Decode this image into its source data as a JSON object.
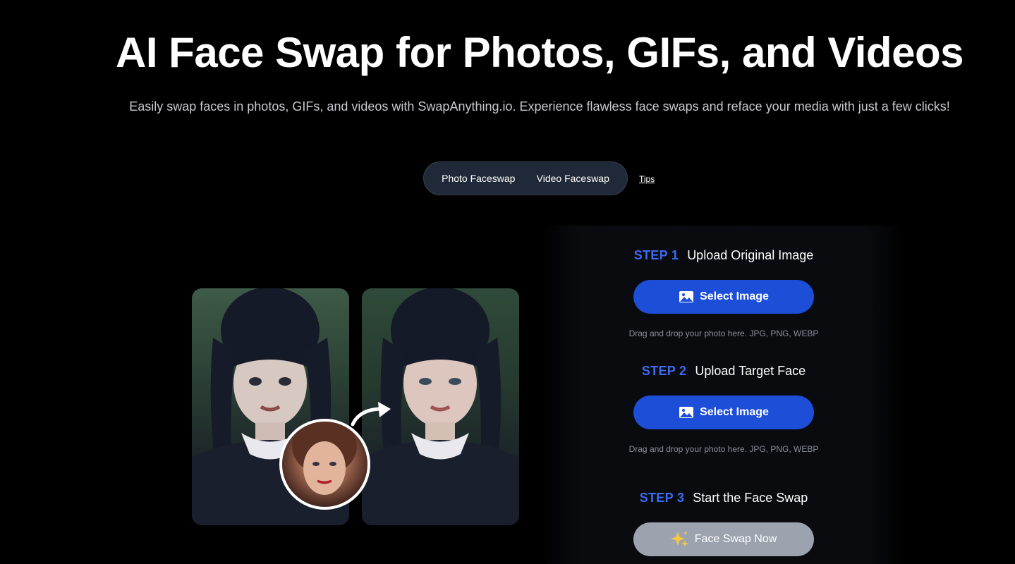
{
  "hero": {
    "title": "AI Face Swap for Photos, GIFs, and Videos",
    "subtitle": "Easily swap faces in photos, GIFs, and videos with SwapAnything.io. Experience flawless face swaps and reface your media with just a few clicks!"
  },
  "tabs": [
    {
      "label": "Photo Faceswap"
    },
    {
      "label": "Video Faceswap"
    }
  ],
  "tips_label": "Tips",
  "steps": [
    {
      "label": "STEP 1",
      "text": "Upload Original Image",
      "button": "Select Image",
      "button_icon": "image-icon",
      "hint": "Drag and drop your photo here. JPG, PNG, WEBP"
    },
    {
      "label": "STEP 2",
      "text": "Upload Target Face",
      "button": "Select Image",
      "button_icon": "image-icon",
      "hint": "Drag and drop your photo here. JPG, PNG, WEBP"
    },
    {
      "label": "STEP 3",
      "text": "Start the Face Swap",
      "button": "Face Swap Now",
      "button_icon": "sparkles-icon"
    }
  ],
  "colors": {
    "background": "#000000",
    "accent": "#1d4ed8",
    "step_label": "#3b6cf0",
    "disabled_button": "#9ca3af"
  }
}
